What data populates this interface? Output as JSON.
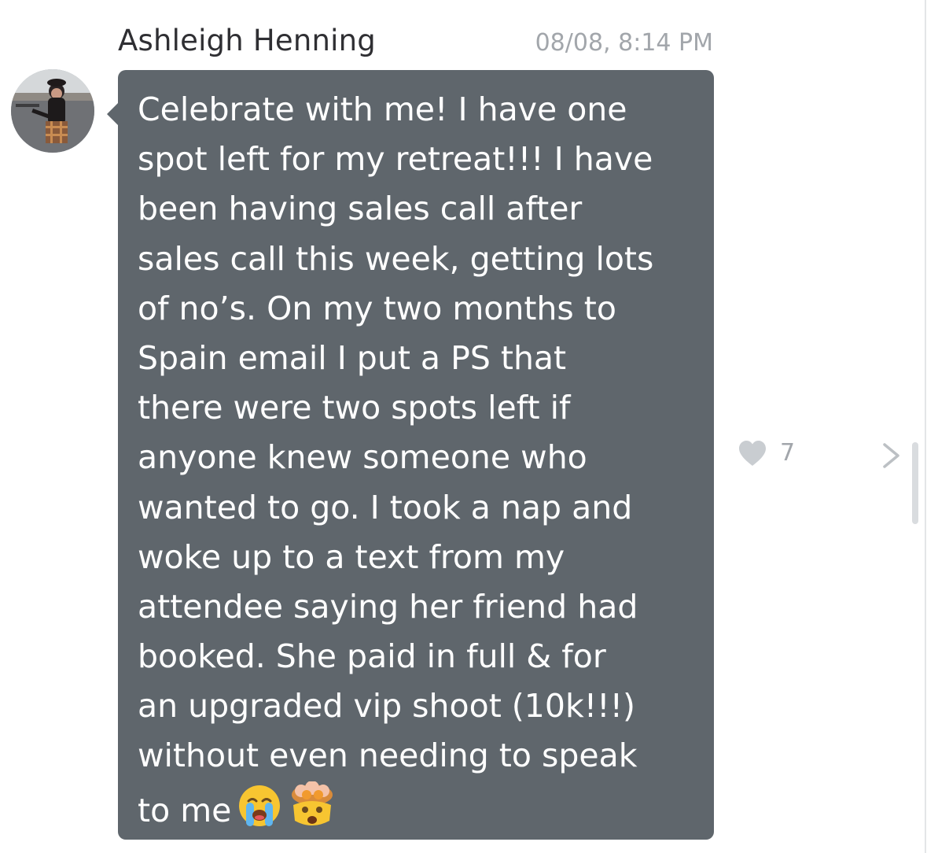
{
  "message": {
    "sender_name": "Ashleigh Henning",
    "timestamp": "08/08, 8:14 PM",
    "text_lines": [
      "Celebrate with me! I have one",
      "spot left for my retreat!!! I have",
      "been having sales call after",
      "sales call this week, getting lots",
      "of no’s. On my two months to",
      "Spain email I put a PS that",
      "there were two spots left if",
      "anyone knew someone who",
      "wanted to go. I took a nap and",
      "woke up to a text from my",
      "attendee saying her friend had",
      "booked. She paid in full & for",
      "an upgraded vip shoot (10k!!!)",
      "without even needing to speak",
      "to me"
    ],
    "emojis": [
      "loudly-crying-face-emoji",
      "exploding-head-emoji"
    ],
    "like_count": "7"
  },
  "icons": {
    "like": "heart-icon",
    "next": "chevron-right-icon"
  },
  "colors": {
    "bubble": "#5f666c",
    "bubble_text": "#ffffff",
    "sender_name": "#2f2f33",
    "meta_text": "#a2a6ab",
    "heart": "#c9cdd1"
  }
}
